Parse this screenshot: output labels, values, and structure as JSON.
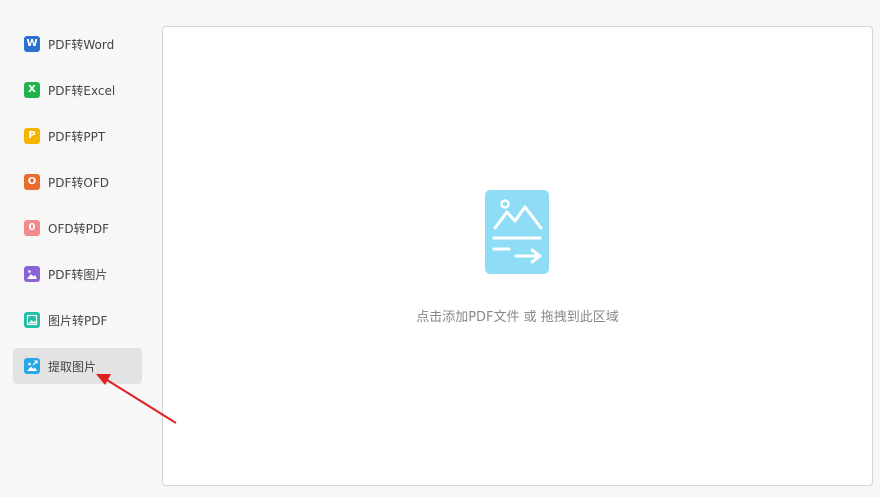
{
  "sidebar": {
    "items": [
      {
        "label": "PDF转Word",
        "icon": "word-icon",
        "icon_letter": "W",
        "color": "#2b6fd1"
      },
      {
        "label": "PDF转Excel",
        "icon": "excel-icon",
        "icon_letter": "X",
        "color": "#22b14c"
      },
      {
        "label": "PDF转PPT",
        "icon": "ppt-icon",
        "icon_letter": "P",
        "color": "#f5b400"
      },
      {
        "label": "PDF转OFD",
        "icon": "ofd-icon",
        "icon_letter": "O",
        "color": "#e86a2c"
      },
      {
        "label": "OFD转PDF",
        "icon": "pdf-icon",
        "icon_letter": "0",
        "color": "#f08a8a"
      },
      {
        "label": "PDF转图片",
        "icon": "image-icon",
        "icon_letter": "",
        "color": "#8a64d6"
      },
      {
        "label": "图片转PDF",
        "icon": "image-to-pdf-icon",
        "icon_letter": "",
        "color": "#1fbfa8"
      },
      {
        "label": "提取图片",
        "icon": "extract-image-icon",
        "icon_letter": "",
        "color": "#2aa7e6",
        "active": true
      }
    ]
  },
  "dropzone": {
    "hint": "点击添加PDF文件 或 拖拽到此区域",
    "icon": "image-document-icon",
    "icon_color": "#8fdcf6"
  },
  "annotation": {
    "arrow_color": "#e02020"
  }
}
